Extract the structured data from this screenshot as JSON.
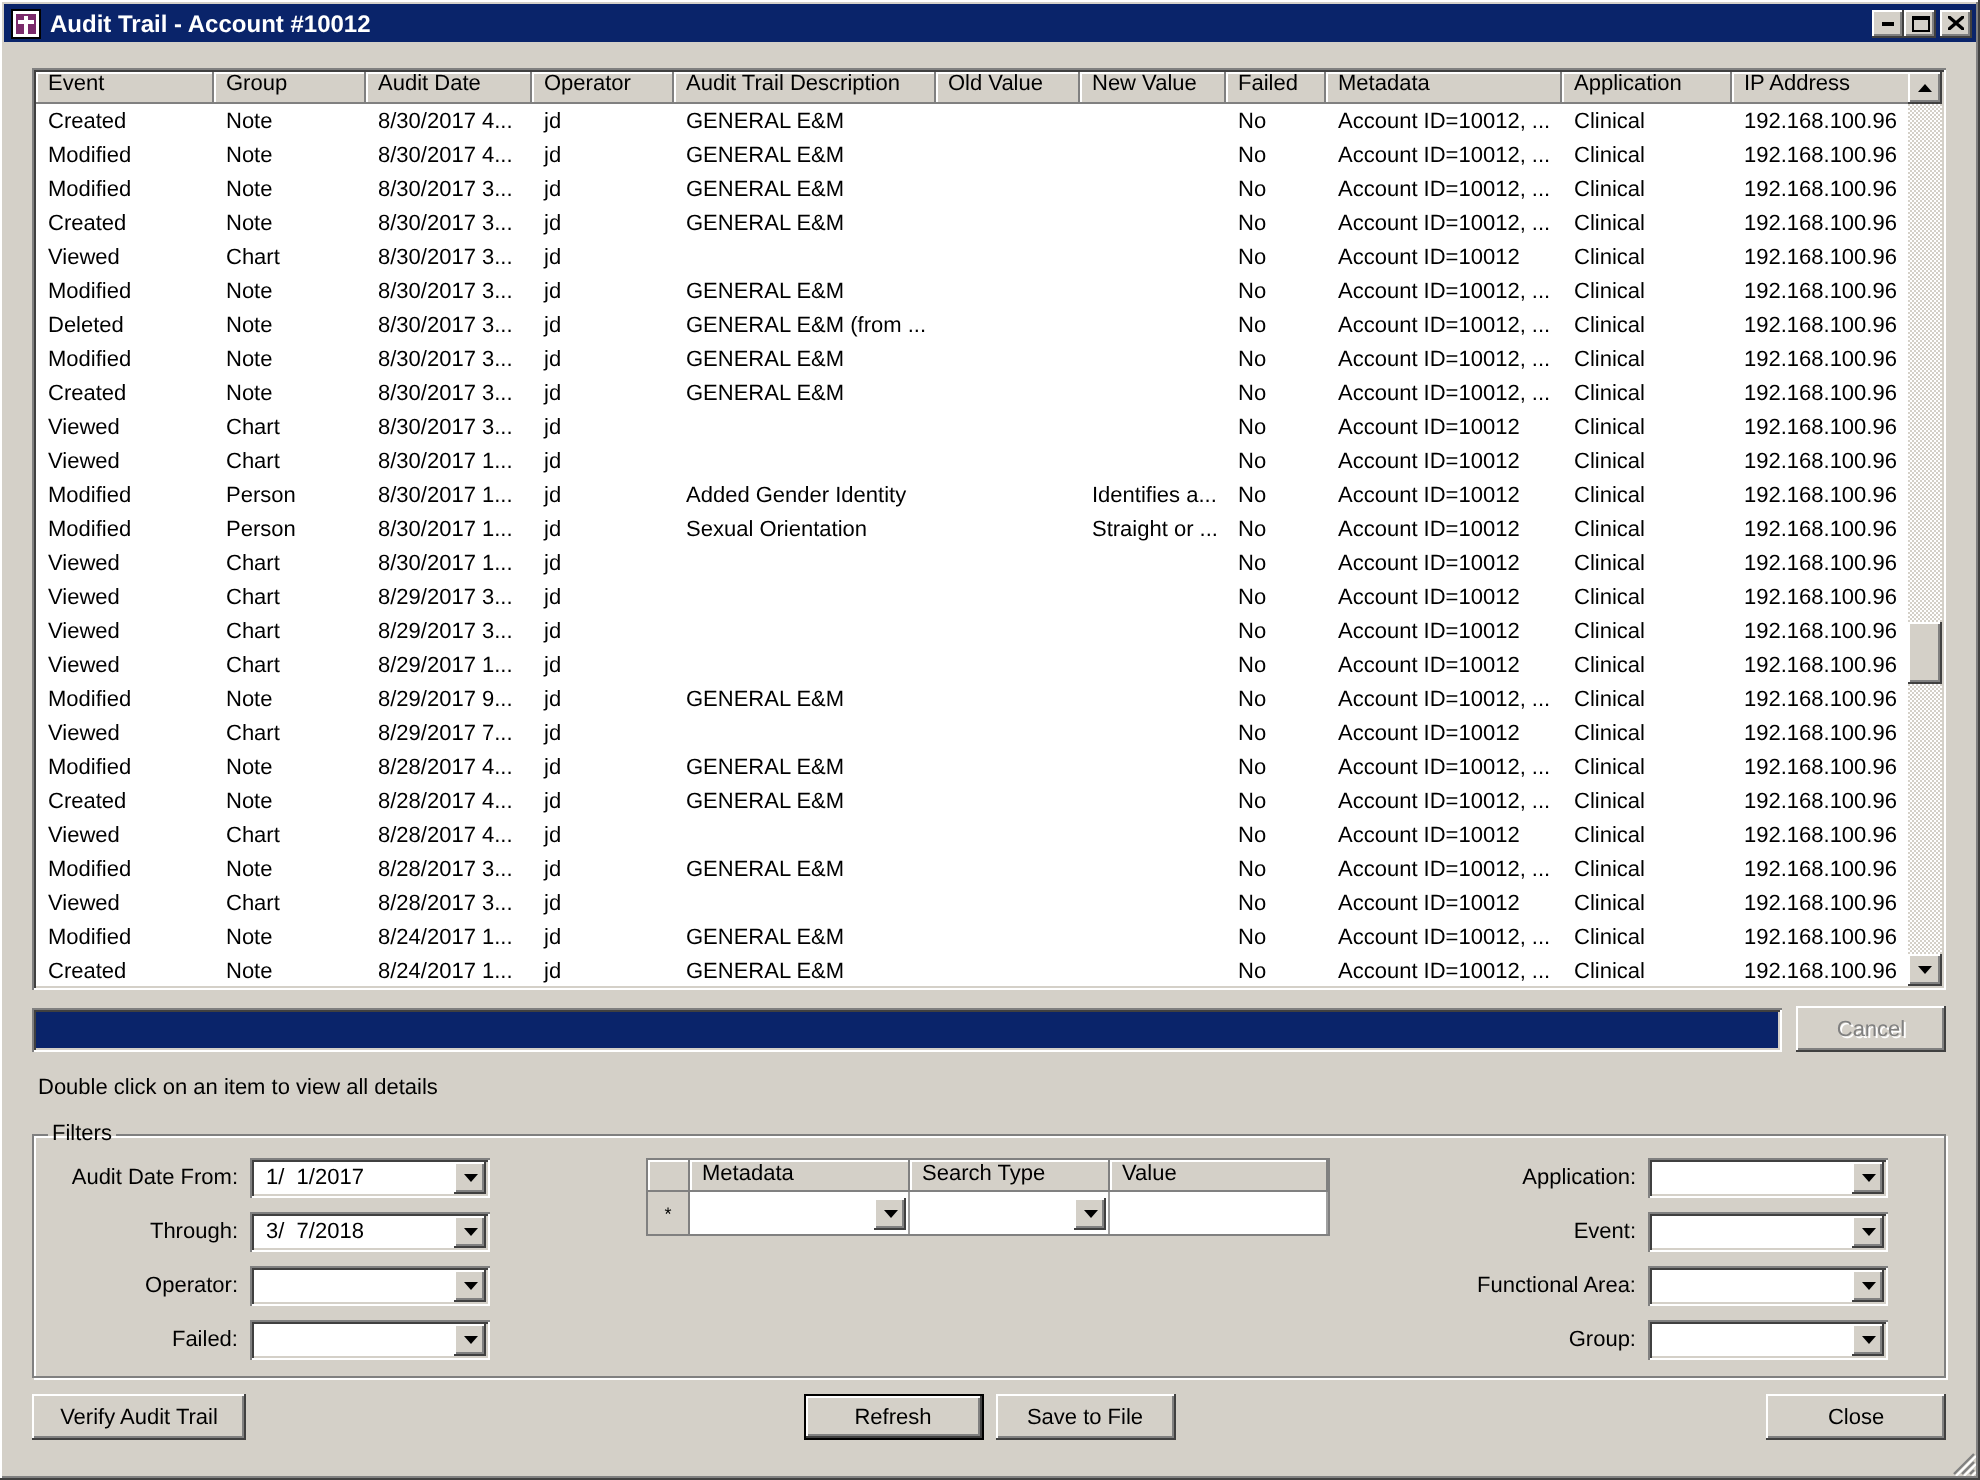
{
  "window": {
    "title": "Audit Trail - Account #10012"
  },
  "table": {
    "columns": [
      "Event",
      "Group",
      "Audit Date",
      "Operator",
      "Audit Trail Description",
      "Old Value",
      "New Value",
      "Failed",
      "Metadata",
      "Application",
      "IP Address"
    ],
    "rows": [
      [
        "Created",
        "Note",
        "8/30/2017 4...",
        "jd",
        "GENERAL E&M",
        "",
        "",
        "No",
        "Account ID=10012, ...",
        "Clinical",
        "192.168.100.96"
      ],
      [
        "Modified",
        "Note",
        "8/30/2017 4...",
        "jd",
        "GENERAL E&M",
        "",
        "",
        "No",
        "Account ID=10012, ...",
        "Clinical",
        "192.168.100.96"
      ],
      [
        "Modified",
        "Note",
        "8/30/2017 3...",
        "jd",
        "GENERAL E&M",
        "",
        "",
        "No",
        "Account ID=10012, ...",
        "Clinical",
        "192.168.100.96"
      ],
      [
        "Created",
        "Note",
        "8/30/2017 3...",
        "jd",
        "GENERAL E&M",
        "",
        "",
        "No",
        "Account ID=10012, ...",
        "Clinical",
        "192.168.100.96"
      ],
      [
        "Viewed",
        "Chart",
        "8/30/2017 3...",
        "jd",
        "",
        "",
        "",
        "No",
        "Account ID=10012",
        "Clinical",
        "192.168.100.96"
      ],
      [
        "Modified",
        "Note",
        "8/30/2017 3...",
        "jd",
        "GENERAL E&M",
        "",
        "",
        "No",
        "Account ID=10012, ...",
        "Clinical",
        "192.168.100.96"
      ],
      [
        "Deleted",
        "Note",
        "8/30/2017 3...",
        "jd",
        "GENERAL E&M (from ...",
        "",
        "",
        "No",
        "Account ID=10012, ...",
        "Clinical",
        "192.168.100.96"
      ],
      [
        "Modified",
        "Note",
        "8/30/2017 3...",
        "jd",
        "GENERAL E&M",
        "",
        "",
        "No",
        "Account ID=10012, ...",
        "Clinical",
        "192.168.100.96"
      ],
      [
        "Created",
        "Note",
        "8/30/2017 3...",
        "jd",
        "GENERAL E&M",
        "",
        "",
        "No",
        "Account ID=10012, ...",
        "Clinical",
        "192.168.100.96"
      ],
      [
        "Viewed",
        "Chart",
        "8/30/2017 3...",
        "jd",
        "",
        "",
        "",
        "No",
        "Account ID=10012",
        "Clinical",
        "192.168.100.96"
      ],
      [
        "Viewed",
        "Chart",
        "8/30/2017 1...",
        "jd",
        "",
        "",
        "",
        "No",
        "Account ID=10012",
        "Clinical",
        "192.168.100.96"
      ],
      [
        "Modified",
        "Person",
        "8/30/2017 1...",
        "jd",
        "Added Gender Identity",
        "",
        "Identifies a...",
        "No",
        "Account ID=10012",
        "Clinical",
        "192.168.100.96"
      ],
      [
        "Modified",
        "Person",
        "8/30/2017 1...",
        "jd",
        "Sexual Orientation",
        "",
        "Straight or ...",
        "No",
        "Account ID=10012",
        "Clinical",
        "192.168.100.96"
      ],
      [
        "Viewed",
        "Chart",
        "8/30/2017 1...",
        "jd",
        "",
        "",
        "",
        "No",
        "Account ID=10012",
        "Clinical",
        "192.168.100.96"
      ],
      [
        "Viewed",
        "Chart",
        "8/29/2017 3...",
        "jd",
        "",
        "",
        "",
        "No",
        "Account ID=10012",
        "Clinical",
        "192.168.100.96"
      ],
      [
        "Viewed",
        "Chart",
        "8/29/2017 3...",
        "jd",
        "",
        "",
        "",
        "No",
        "Account ID=10012",
        "Clinical",
        "192.168.100.96"
      ],
      [
        "Viewed",
        "Chart",
        "8/29/2017 1...",
        "jd",
        "",
        "",
        "",
        "No",
        "Account ID=10012",
        "Clinical",
        "192.168.100.96"
      ],
      [
        "Modified",
        "Note",
        "8/29/2017 9...",
        "jd",
        "GENERAL E&M",
        "",
        "",
        "No",
        "Account ID=10012, ...",
        "Clinical",
        "192.168.100.96"
      ],
      [
        "Viewed",
        "Chart",
        "8/29/2017 7...",
        "jd",
        "",
        "",
        "",
        "No",
        "Account ID=10012",
        "Clinical",
        "192.168.100.96"
      ],
      [
        "Modified",
        "Note",
        "8/28/2017 4...",
        "jd",
        "GENERAL E&M",
        "",
        "",
        "No",
        "Account ID=10012, ...",
        "Clinical",
        "192.168.100.96"
      ],
      [
        "Created",
        "Note",
        "8/28/2017 4...",
        "jd",
        "GENERAL E&M",
        "",
        "",
        "No",
        "Account ID=10012, ...",
        "Clinical",
        "192.168.100.96"
      ],
      [
        "Viewed",
        "Chart",
        "8/28/2017 4...",
        "jd",
        "",
        "",
        "",
        "No",
        "Account ID=10012",
        "Clinical",
        "192.168.100.96"
      ],
      [
        "Modified",
        "Note",
        "8/28/2017 3...",
        "jd",
        "GENERAL E&M",
        "",
        "",
        "No",
        "Account ID=10012, ...",
        "Clinical",
        "192.168.100.96"
      ],
      [
        "Viewed",
        "Chart",
        "8/28/2017 3...",
        "jd",
        "",
        "",
        "",
        "No",
        "Account ID=10012",
        "Clinical",
        "192.168.100.96"
      ],
      [
        "Modified",
        "Note",
        "8/24/2017 1...",
        "jd",
        "GENERAL E&M",
        "",
        "",
        "No",
        "Account ID=10012, ...",
        "Clinical",
        "192.168.100.96"
      ],
      [
        "Created",
        "Note",
        "8/24/2017 1...",
        "jd",
        "GENERAL E&M",
        "",
        "",
        "No",
        "Account ID=10012, ...",
        "Clinical",
        "192.168.100.96"
      ]
    ]
  },
  "progress": {
    "level": 1
  },
  "cancel_button": {
    "label": "Cancel",
    "disabled": true
  },
  "hint": "Double click on an item to view all details",
  "filters": {
    "title": "Filters",
    "left": [
      {
        "label": "Audit Date From:",
        "value": "1/  1/2017"
      },
      {
        "label": "Through:",
        "value": "3/  7/2018"
      },
      {
        "label": "Operator:"
      },
      {
        "label": "Failed:"
      }
    ],
    "metadata_grid": {
      "columns": [
        "Metadata",
        "Search Type",
        "Value"
      ],
      "new_row_marker": "*"
    },
    "right": [
      {
        "label": "Application:"
      },
      {
        "label": "Event:"
      },
      {
        "label": "Functional Area:"
      },
      {
        "label": "Group:"
      }
    ]
  },
  "buttons": [
    {
      "label": "Verify Audit Trail",
      "default": false
    },
    {
      "label": "Refresh",
      "default": true
    },
    {
      "label": "Save to File",
      "default": false
    },
    {
      "label": "Close",
      "default": false
    }
  ]
}
